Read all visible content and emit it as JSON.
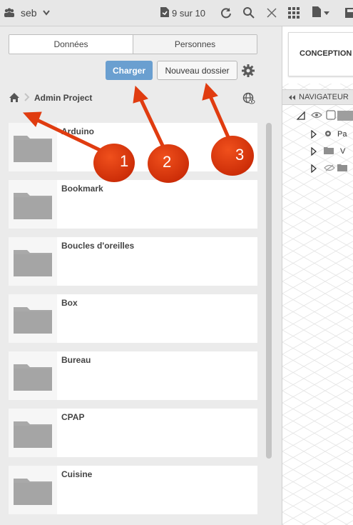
{
  "topbar": {
    "team_name": "seb",
    "jobs_status": "9 sur 10",
    "icons": [
      "team-icon",
      "chevron-down-icon",
      "document-status-icon",
      "refresh-icon",
      "search-icon",
      "close-icon",
      "grid-icon",
      "file-icon",
      "save-icon"
    ]
  },
  "panel": {
    "tabs": [
      {
        "label": "Données",
        "selected": true
      },
      {
        "label": "Personnes",
        "selected": false
      }
    ],
    "upload_button": "Charger",
    "new_folder_button": "Nouveau dossier",
    "breadcrumb": {
      "project": "Admin Project"
    },
    "folders": [
      {
        "name": "Arduino"
      },
      {
        "name": "Bookmark"
      },
      {
        "name": "Boucles d'oreilles"
      },
      {
        "name": "Box"
      },
      {
        "name": "Bureau"
      },
      {
        "name": "CPAP"
      },
      {
        "name": "Cuisine"
      }
    ]
  },
  "canvas": {
    "workspace_label": "CONCEPTION",
    "navigator_label": "NAVIGATEUR",
    "browser_items": [
      {
        "text": "Pa"
      },
      {
        "text": "V"
      },
      {
        "text": ""
      }
    ]
  },
  "annotations": [
    {
      "number": "1"
    },
    {
      "number": "2"
    },
    {
      "number": "3"
    }
  ],
  "colors": {
    "primary_button": "#6a9fd0",
    "annotation": "#e03c10",
    "folder": "#a9a9a9"
  }
}
